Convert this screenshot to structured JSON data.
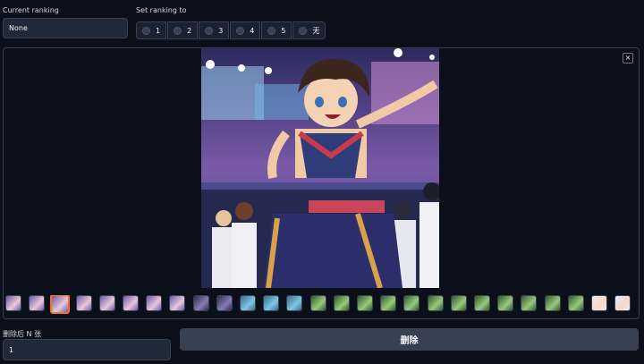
{
  "current_ranking": {
    "label": "Current ranking",
    "value": "None"
  },
  "set_ranking": {
    "label": "Set ranking to",
    "options": [
      "1",
      "2",
      "3",
      "4",
      "5",
      "无"
    ]
  },
  "gallery": {
    "close_glyph": "×",
    "selected_index": 2,
    "thumbnail_kinds": [
      "anime",
      "anime",
      "anime",
      "anime",
      "anime",
      "anime",
      "anime",
      "anime",
      "dark-anime",
      "dark-anime",
      "road",
      "road",
      "road",
      "landscape",
      "landscape",
      "landscape",
      "landscape",
      "landscape",
      "landscape",
      "landscape",
      "landscape",
      "landscape",
      "landscape",
      "landscape",
      "landscape",
      "portrait-light",
      "portrait-light",
      "portrait-light"
    ]
  },
  "delete_after": {
    "label": "删除后 N 张",
    "value": "1"
  },
  "delete_button": {
    "label": "删除"
  },
  "colors": {
    "background": "#0b0f19",
    "accent_selected": "#f97316",
    "button": "#374151"
  }
}
